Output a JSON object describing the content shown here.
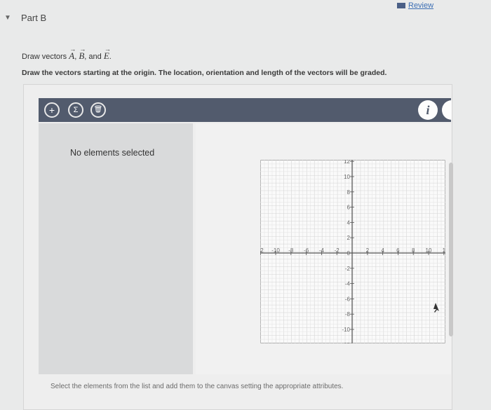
{
  "header": {
    "collapse_symbol": "▼",
    "part_title": "Part B",
    "review_label": "Review",
    "review_icon": "book-icon"
  },
  "question": {
    "prompt_prefix": "Draw vectors",
    "vectors": [
      "A",
      "B",
      "E"
    ],
    "sep1": ",",
    "sep2": ", and",
    "end": ".",
    "instruction": "Draw the vectors starting at the origin. The location, orientation and length of the vectors will be graded."
  },
  "toolbar": {
    "add_symbol": "+",
    "sum_symbol": "Σ",
    "trash_symbol": "🗑",
    "info_symbol": "i",
    "color": "#525b6d"
  },
  "element_list": {
    "empty_text": "No elements selected"
  },
  "graph": {
    "x_ticks": [
      "12",
      "-10",
      "-8",
      "-6",
      "-4",
      "-2",
      "2",
      "4",
      "6",
      "8",
      "10",
      "1"
    ],
    "y_ticks": [
      "12",
      "10",
      "8",
      "6",
      "4",
      "2",
      "0",
      "-2",
      "-4",
      "-6",
      "-8",
      "-10",
      "12"
    ],
    "x_range": [
      -12,
      12
    ],
    "y_range": [
      -12,
      12
    ],
    "grid": true
  },
  "footer": {
    "hint": "Select the elements from the list and add them to the canvas setting the appropriate attributes."
  }
}
